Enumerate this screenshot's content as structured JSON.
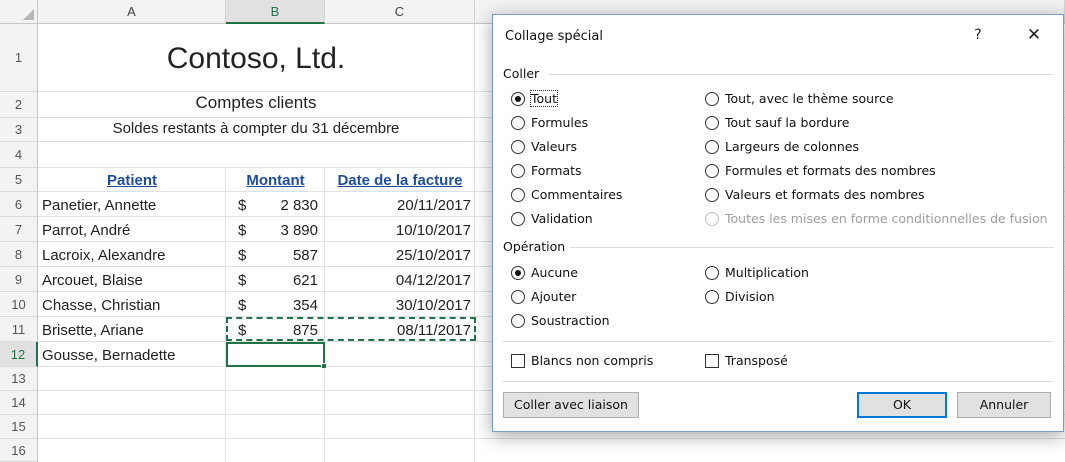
{
  "spreadsheet": {
    "columns": [
      "A",
      "B",
      "C"
    ],
    "rows": [
      "1",
      "2",
      "3",
      "4",
      "5",
      "6",
      "7",
      "8",
      "9",
      "10",
      "11",
      "12",
      "13",
      "14",
      "15",
      "16"
    ],
    "title": "Contoso, Ltd.",
    "subtitle": "Comptes clients",
    "subtitle2": "Soldes restants à compter du 31 décembre",
    "headers": {
      "patient": "Patient",
      "montant": "Montant",
      "date": "Date de la facture"
    },
    "currency": "$",
    "data": [
      {
        "name": "Panetier, Annette",
        "amount": "2 830",
        "date": "20/11/2017"
      },
      {
        "name": "Parrot, André",
        "amount": "3 890",
        "date": "10/10/2017"
      },
      {
        "name": "Lacroix, Alexandre",
        "amount": "587",
        "date": "25/10/2017"
      },
      {
        "name": "Arcouet, Blaise",
        "amount": "621",
        "date": "04/12/2017"
      },
      {
        "name": "Chasse, Christian",
        "amount": "354",
        "date": "30/10/2017"
      },
      {
        "name": "Brisette, Ariane",
        "amount": "875",
        "date": "08/11/2017"
      },
      {
        "name": "Gousse, Bernadette",
        "amount": "",
        "date": ""
      }
    ],
    "accent": "#217346",
    "header_color": "#1f4e9e"
  },
  "dialog": {
    "title": "Collage spécial",
    "help": "?",
    "close": "✕",
    "coller_label": "Coller",
    "paste_left": [
      {
        "label": "Tout",
        "checked": true
      },
      {
        "label": "Formules",
        "checked": false
      },
      {
        "label": "Valeurs",
        "checked": false
      },
      {
        "label": "Formats",
        "checked": false
      },
      {
        "label": "Commentaires",
        "checked": false
      },
      {
        "label": "Validation",
        "checked": false
      }
    ],
    "paste_right": [
      {
        "label": "Tout, avec le thème source",
        "checked": false
      },
      {
        "label": "Tout sauf la bordure",
        "checked": false
      },
      {
        "label": "Largeurs de colonnes",
        "checked": false
      },
      {
        "label": "Formules et formats des nombres",
        "checked": false
      },
      {
        "label": "Valeurs et formats des nombres",
        "checked": false
      },
      {
        "label": "Toutes les mises en forme conditionnelles de fusion",
        "checked": false,
        "disabled": true
      }
    ],
    "operation_label": "Opération",
    "op_left": [
      {
        "label": "Aucune",
        "checked": true
      },
      {
        "label": "Ajouter",
        "checked": false
      },
      {
        "label": "Soustraction",
        "checked": false
      }
    ],
    "op_right": [
      {
        "label": "Multiplication",
        "checked": false
      },
      {
        "label": "Division",
        "checked": false
      }
    ],
    "skip_blanks": "Blancs non compris",
    "transpose": "Transposé",
    "paste_link": "Coller avec liaison",
    "ok": "OK",
    "cancel": "Annuler",
    "focus_color": "#0078d7"
  }
}
